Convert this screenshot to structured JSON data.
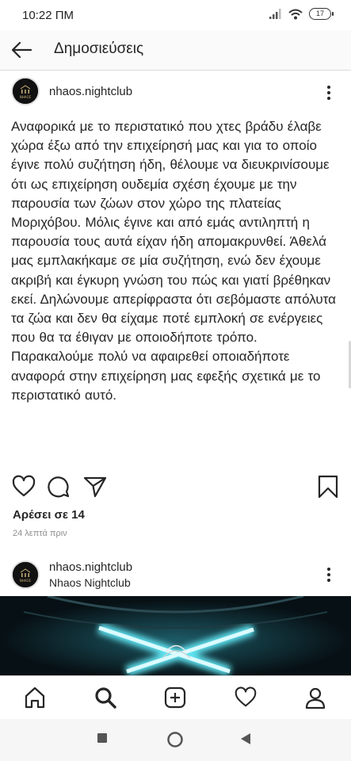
{
  "status_bar": {
    "time": "10:22 ΠΜ",
    "battery": "17"
  },
  "header": {
    "title": "Δημοσιεύσεις"
  },
  "posts": [
    {
      "username": "nhaos.nightclub",
      "avatar_text": "ΝΗΑΟΣ",
      "caption": "Αναφορικά με το περιστατικό που χτες βράδυ έλαβε χώρα έξω από την επιχείρησή μας και για το οποίο έγινε πολύ συζήτηση ήδη, θέλουμε να διευκρινίσουμε ότι ως επιχείρηση ουδεμία σχέση έχουμε με την παρουσία των ζώων στον χώρο της πλατείας Μοριχόβου. Μόλις έγινε και από εμάς αντιληπτή η παρουσία τους αυτά είχαν ήδη απομακρυνθεί. Άθελά μας εμπλακήκαμε σε μία συζήτηση, ενώ δεν έχουμε ακριβή και έγκυρη γνώση του πώς και γιατί βρέθηκαν εκεί. Δηλώνουμε απερίφραστα ότι σεβόμαστε απόλυτα τα ζώα και δεν θα είχαμε ποτέ εμπλοκή σε ενέργειες που θα τα έθιγαν με οποιοδήποτε τρόπο. Παρακαλούμε πολύ να αφαιρεθεί οποιαδήποτε αναφορά στην επιχείρηση μας εφεξής σχετικά με το περιστατικό αυτό.",
      "likes": "Αρέσει σε 14",
      "time_ago": "24 λεπτά πριν"
    },
    {
      "username": "nhaos.nightclub",
      "subtitle": "Nhaos Nightclub",
      "avatar_text": "ΝΗΑΟΣ"
    }
  ],
  "icons": {
    "back": "arrow-left-icon",
    "more": "more-vertical-icon",
    "like": "heart-icon",
    "comment": "comment-icon",
    "share": "send-icon",
    "save": "bookmark-icon",
    "tabs": [
      "home-icon",
      "search-icon",
      "add-icon",
      "activity-heart-icon",
      "profile-icon"
    ],
    "system": [
      "recents-square-icon",
      "home-circle-icon",
      "back-triangle-icon"
    ]
  },
  "colors": {
    "text": "#262626",
    "secondary": "#8e8e8e",
    "divider": "#dbdbdb",
    "neon": "#5fe3f0"
  }
}
